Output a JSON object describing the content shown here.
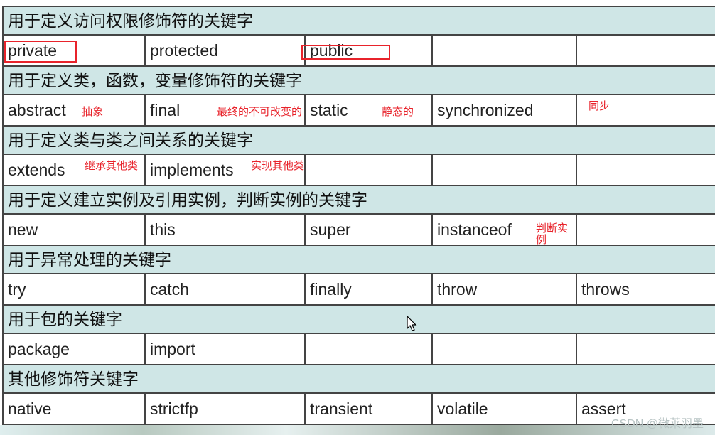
{
  "sections": [
    {
      "title": "用于定义访问权限修饰符的关键字",
      "cells": [
        {
          "kw": "private"
        },
        {
          "kw": "protected"
        },
        {
          "kw": "public"
        },
        {
          "kw": ""
        },
        {
          "kw": ""
        }
      ]
    },
    {
      "title": "用于定义类，函数，变量修饰符的关键字",
      "cells": [
        {
          "kw": "abstract",
          "note": "抽象"
        },
        {
          "kw": "final",
          "note": "最终的不可改变的"
        },
        {
          "kw": "static",
          "note": "静态的"
        },
        {
          "kw": "synchronized"
        },
        {
          "kw": "",
          "note": "同步"
        }
      ]
    },
    {
      "title": "用于定义类与类之间关系的关键字",
      "cells": [
        {
          "kw": "extends",
          "note": "继承其他类"
        },
        {
          "kw": "implements",
          "note": "实现其他类"
        },
        {
          "kw": ""
        },
        {
          "kw": ""
        },
        {
          "kw": ""
        }
      ]
    },
    {
      "title": "用于定义建立实例及引用实例，判断实例的关键字",
      "cells": [
        {
          "kw": "new"
        },
        {
          "kw": "this"
        },
        {
          "kw": "super"
        },
        {
          "kw": "instanceof",
          "note": "判断实例"
        },
        {
          "kw": ""
        }
      ]
    },
    {
      "title": "用于异常处理的关键字",
      "cells": [
        {
          "kw": "try"
        },
        {
          "kw": "catch"
        },
        {
          "kw": "finally"
        },
        {
          "kw": "throw"
        },
        {
          "kw": "throws"
        }
      ]
    },
    {
      "title": "用于包的关键字",
      "cells": [
        {
          "kw": "package"
        },
        {
          "kw": "import"
        },
        {
          "kw": ""
        },
        {
          "kw": ""
        },
        {
          "kw": ""
        }
      ]
    },
    {
      "title": "其他修饰符关键字",
      "cells": [
        {
          "kw": "native"
        },
        {
          "kw": "strictfp"
        },
        {
          "kw": "transient"
        },
        {
          "kw": "volatile"
        },
        {
          "kw": "assert"
        }
      ]
    }
  ],
  "watermark": "CSDN @微莱羽墨",
  "colors": {
    "header_bg": "#cfe6e6",
    "annotation": "#e8232b"
  }
}
